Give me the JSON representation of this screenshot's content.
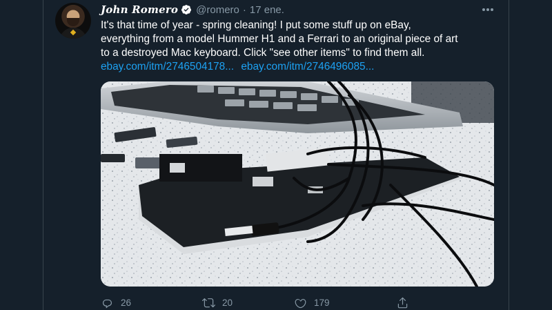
{
  "tweet": {
    "author_name": "John Romero",
    "handle": "@romero",
    "separator": "·",
    "date": "17 ene.",
    "text_lines": [
      "It's that time of year - spring cleaning! I put some stuff up on eBay,",
      "everything from a model Hummer H1 and a Ferrari to an original piece of art",
      "to a destroyed Mac keyboard. Click \"see other items\" to find them all."
    ],
    "links": [
      "ebay.com/itm/2746504178...",
      "ebay.com/itm/2746496085..."
    ],
    "media_description_icon": "photo-destroyed-mac-keyboard",
    "actions": {
      "reply_count": "26",
      "retweet_count": "20",
      "like_count": "179"
    }
  },
  "colors": {
    "background": "#15202b",
    "border": "#38444d",
    "text": "#ffffff",
    "secondary": "#8899a6",
    "link": "#1da1f2"
  },
  "icons": [
    "verified-badge-icon",
    "more-options-icon",
    "reply-icon",
    "retweet-icon",
    "like-icon",
    "share-icon"
  ]
}
